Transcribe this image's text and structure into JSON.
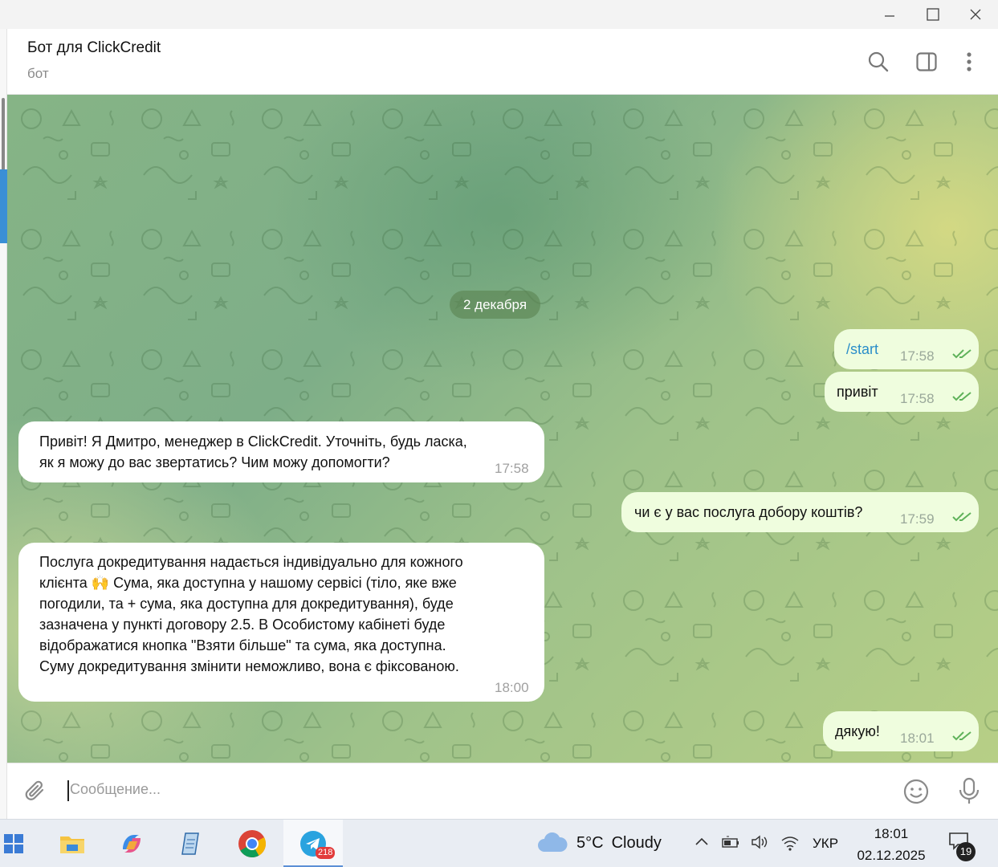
{
  "chat": {
    "title": "Бот для ClickCredit",
    "subtitle": "бот",
    "date_separator": "2 декабря"
  },
  "messages": [
    {
      "dir": "out",
      "text": "/start",
      "time": "17:58",
      "is_command": true
    },
    {
      "dir": "out",
      "text": "привіт",
      "time": "17:58"
    },
    {
      "dir": "in",
      "lines": [
        "Привіт! Я Дмитро, менеджер в ClickCredit. Уточніть, будь ласка,",
        "як я можу до вас звертатись? Чим можу допомогти?"
      ],
      "time": "17:58"
    },
    {
      "dir": "out",
      "text": "чи є у вас послуга добору коштів?",
      "time": "17:59"
    },
    {
      "dir": "in",
      "lines": [
        "Послуга докредитування надається індивідуально для кожного",
        "клієнта 🙌 Сума, яка доступна у нашому сервісі (тіло, яке вже",
        "погодили, та + сума, яка доступна для докредитування), буде",
        "зазначена у пункті договору 2.5. В Особистому кабінеті буде",
        "відображатися кнопка \"Взяти більше\" та сума, яка доступна.",
        "Суму докредитування змінити неможливо, вона є фіксованою."
      ],
      "time": "18:00"
    },
    {
      "dir": "out",
      "text": "дякую!",
      "time": "18:01"
    }
  ],
  "input": {
    "placeholder": "Сообщение..."
  },
  "taskbar": {
    "telegram_badge": "218",
    "weather_temp": "5°C",
    "weather_text": "Cloudy",
    "language": "УКР",
    "time": "18:01",
    "date": "02.12.2025",
    "notifications": "19"
  },
  "colors": {
    "outgoing_bubble": "#effdde",
    "incoming_bubble": "#ffffff",
    "check_color": "#5fb25a",
    "command_color": "#2a8ec9"
  },
  "icons": [
    "minimize-icon",
    "maximize-icon",
    "close-icon",
    "search-icon",
    "sidebar-toggle-icon",
    "more-icon",
    "attach-icon",
    "emoji-icon",
    "microphone-icon",
    "start-icon",
    "file-explorer-icon",
    "copilot-icon",
    "notepad-icon",
    "chrome-icon",
    "telegram-icon",
    "weather-cloud-icon",
    "chevron-up-icon",
    "battery-icon",
    "volume-icon",
    "wifi-icon",
    "notification-icon"
  ]
}
